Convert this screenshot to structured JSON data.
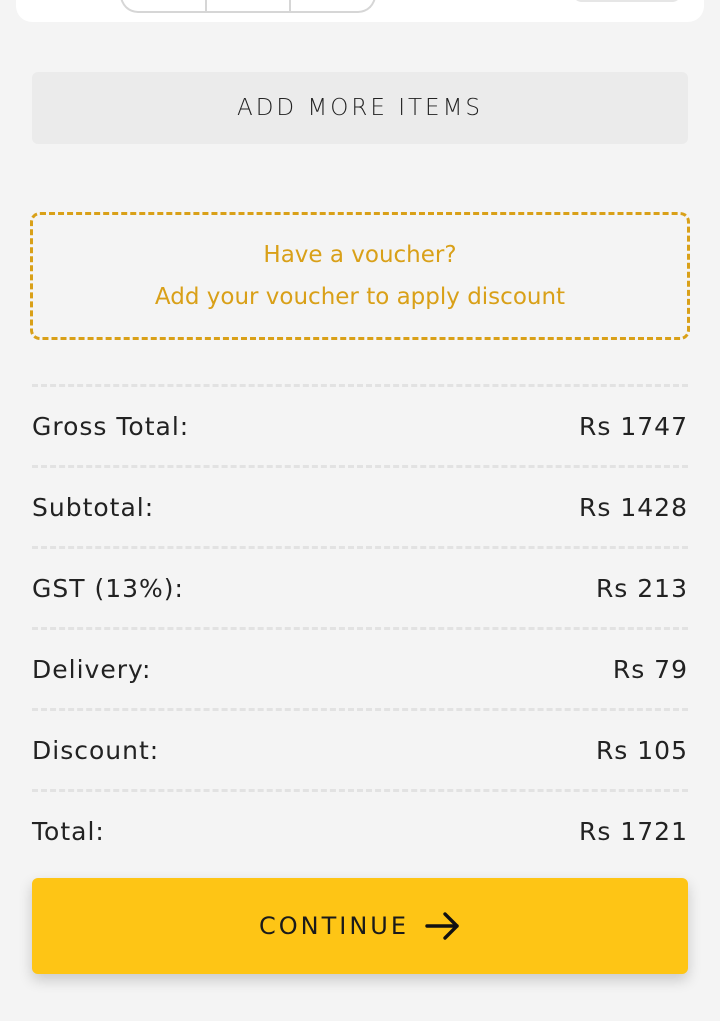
{
  "actions": {
    "add_more_label": "ADD MORE ITEMS",
    "continue_label": "CONTINUE",
    "continue_icon": "arrow-right-icon"
  },
  "voucher": {
    "title": "Have a voucher?",
    "subtitle": "Add your voucher to apply discount",
    "color": "#d9a018"
  },
  "summary": {
    "rows": [
      {
        "label": "Gross Total:",
        "value": "Rs 1747"
      },
      {
        "label": "Subtotal:",
        "value": "Rs 1428"
      },
      {
        "label": "GST (13%):",
        "value": "Rs 213"
      },
      {
        "label": "Delivery:",
        "value": "Rs 79"
      },
      {
        "label": "Discount:",
        "value": "Rs 105"
      },
      {
        "label": "Total:",
        "value": "Rs 1721"
      }
    ]
  },
  "colors": {
    "accent": "#fec515",
    "voucher": "#d9a018",
    "secondary_button": "#ebebeb"
  }
}
